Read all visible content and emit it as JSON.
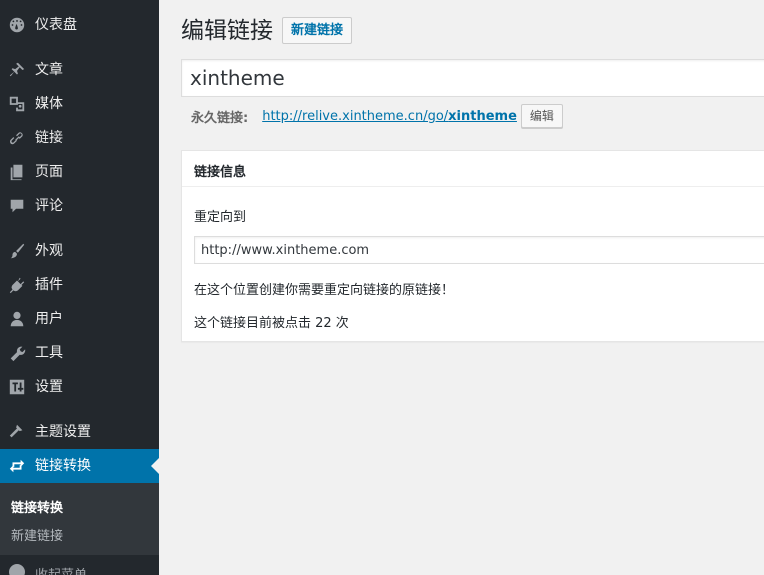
{
  "sidebar": {
    "items": [
      {
        "label": "仪表盘",
        "icon": "dashboard-icon"
      },
      {
        "label": "文章",
        "icon": "pin-icon"
      },
      {
        "label": "媒体",
        "icon": "media-icon"
      },
      {
        "label": "链接",
        "icon": "link-icon"
      },
      {
        "label": "页面",
        "icon": "page-icon"
      },
      {
        "label": "评论",
        "icon": "comment-icon"
      },
      {
        "label": "外观",
        "icon": "brush-icon"
      },
      {
        "label": "插件",
        "icon": "plugin-icon"
      },
      {
        "label": "用户",
        "icon": "user-icon"
      },
      {
        "label": "工具",
        "icon": "wrench-icon"
      },
      {
        "label": "设置",
        "icon": "settings-icon"
      },
      {
        "label": "主题设置",
        "icon": "hammer-icon"
      },
      {
        "label": "链接转换",
        "icon": "repeat-icon",
        "active": true
      }
    ],
    "submenu": [
      {
        "label": "链接转换",
        "current": true
      },
      {
        "label": "新建链接"
      }
    ],
    "collapse_label": "收起菜单"
  },
  "main": {
    "page_title": "编辑链接",
    "add_new_label": "新建链接",
    "title_value": "xintheme",
    "permalink": {
      "label": "永久链接:",
      "url_prefix": "http://relive.xintheme.cn/go/",
      "url_slug": "xintheme",
      "edit_label": "编辑"
    },
    "postbox": {
      "title": "链接信息",
      "redirect_label": "重定向到",
      "redirect_value": "http://www.xintheme.com",
      "help_text": "在这个位置创建你需要重定向链接的原链接！",
      "click_text": "这个链接目前被点击 22 次"
    }
  },
  "colors": {
    "sidebar_bg": "#23282d",
    "submenu_bg": "#32373c",
    "active_bg": "#0073aa",
    "link": "#0073aa",
    "content_bg": "#f1f1f1"
  }
}
